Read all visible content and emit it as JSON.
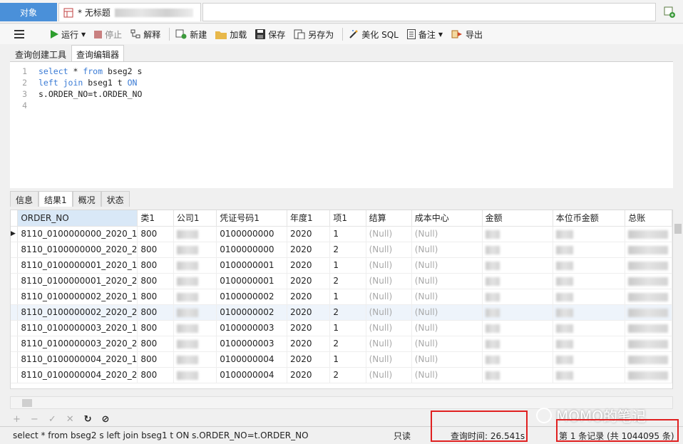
{
  "tabs": {
    "object_label": "对象",
    "query_tab_title": "* 无标题"
  },
  "toolbar": {
    "run": "运行",
    "stop": "停止",
    "explain": "解释",
    "new": "新建",
    "load": "加载",
    "save": "保存",
    "save_as": "另存为",
    "beautify": "美化 SQL",
    "note": "备注",
    "export": "导出"
  },
  "subtabs": {
    "builder": "查询创建工具",
    "editor": "查询编辑器"
  },
  "sql": {
    "line_numbers": [
      "1",
      "2",
      "3",
      "4"
    ],
    "l1_kw1": "select",
    "l1_star": " * ",
    "l1_kw2": "from",
    "l1_rest": " bseg2 s",
    "l2_kw1": "left join",
    "l2_mid": " bseg1 t ",
    "l2_kw2": "ON",
    "l3": "s.ORDER_NO=t.ORDER_NO"
  },
  "result_tabs": {
    "info": "信息",
    "result1": "结果1",
    "overview": "概况",
    "status": "状态"
  },
  "grid": {
    "columns": [
      "ORDER_NO",
      "类1",
      "公司1",
      "凭证号码1",
      "年度1",
      "项1",
      "结算",
      "成本中心",
      "金额",
      "本位币金额",
      "总账"
    ],
    "null_text": "(Null)",
    "rows": [
      {
        "order": "8110_0100000000_2020_1",
        "c1": "800",
        "doc": "0100000000",
        "year": "2020",
        "item": "1"
      },
      {
        "order": "8110_0100000000_2020_2",
        "c1": "800",
        "doc": "0100000000",
        "year": "2020",
        "item": "2"
      },
      {
        "order": "8110_0100000001_2020_1",
        "c1": "800",
        "doc": "0100000001",
        "year": "2020",
        "item": "1"
      },
      {
        "order": "8110_0100000001_2020_2",
        "c1": "800",
        "doc": "0100000001",
        "year": "2020",
        "item": "2"
      },
      {
        "order": "8110_0100000002_2020_1",
        "c1": "800",
        "doc": "0100000002",
        "year": "2020",
        "item": "1"
      },
      {
        "order": "8110_0100000002_2020_2",
        "c1": "800",
        "doc": "0100000002",
        "year": "2020",
        "item": "2"
      },
      {
        "order": "8110_0100000003_2020_1",
        "c1": "800",
        "doc": "0100000003",
        "year": "2020",
        "item": "1"
      },
      {
        "order": "8110_0100000003_2020_2",
        "c1": "800",
        "doc": "0100000003",
        "year": "2020",
        "item": "2"
      },
      {
        "order": "8110_0100000004_2020_1",
        "c1": "800",
        "doc": "0100000004",
        "year": "2020",
        "item": "1"
      },
      {
        "order": "8110_0100000004_2020_2",
        "c1": "800",
        "doc": "0100000004",
        "year": "2020",
        "item": "2"
      }
    ]
  },
  "grid_controls": [
    "+",
    "−",
    "✓",
    "✕",
    "↻",
    "⊘"
  ],
  "statusbar": {
    "sql": "select * from bseg2 s left join bseg1 t ON s.ORDER_NO=t.ORDER_NO",
    "readonly": "只读",
    "query_time": "查询时间: 26.541s",
    "records": "第 1 条记录 (共 1044095 条)"
  },
  "watermark": "MOMO的笔记",
  "colors": {
    "accent": "#4a90d9",
    "keyword": "#3a7bd5",
    "highlight_box": "#e02020",
    "null_text": "#a8a8a8"
  }
}
